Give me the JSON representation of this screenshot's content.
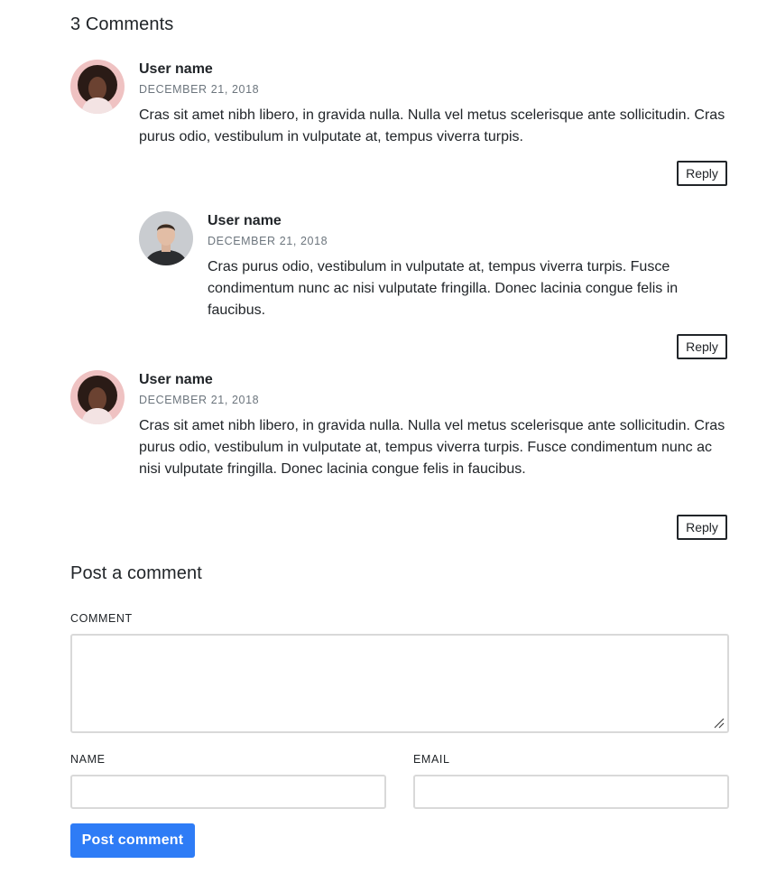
{
  "comments_section": {
    "title": "3 Comments",
    "comments": [
      {
        "name": "User name",
        "date": "DECEMBER 21, 2018",
        "body": "Cras sit amet nibh libero, in gravida nulla. Nulla vel metus scelerisque ante sollicitudin. Cras purus odio, vestibulum in vulputate at, tempus viverra turpis.",
        "reply_label": "Reply",
        "avatar": "woman-avatar"
      },
      {
        "name": "User name",
        "date": "DECEMBER 21, 2018",
        "body": "Cras purus odio, vestibulum in vulputate at, tempus viverra turpis. Fusce condimentum nunc ac nisi vulputate fringilla. Donec lacinia congue felis in faucibus.",
        "reply_label": "Reply",
        "avatar": "man-avatar"
      },
      {
        "name": "User name",
        "date": "DECEMBER 21, 2018",
        "body": "Cras sit amet nibh libero, in gravida nulla. Nulla vel metus scelerisque ante sollicitudin. Cras purus odio, vestibulum in vulputate at, tempus viverra turpis. Fusce condimentum nunc ac nisi vulputate fringilla. Donec lacinia congue felis in faucibus.",
        "reply_label": "Reply",
        "avatar": "woman-avatar"
      }
    ]
  },
  "comment_form": {
    "title": "Post a comment",
    "comment_label": "COMMENT",
    "comment_value": "",
    "name_label": "NAME",
    "name_value": "",
    "email_label": "EMAIL",
    "email_value": "",
    "submit_label": "Post comment"
  },
  "colors": {
    "primary": "#2e7cf6",
    "text": "#212529",
    "muted": "#6c757d",
    "border": "#d9d9d9"
  }
}
